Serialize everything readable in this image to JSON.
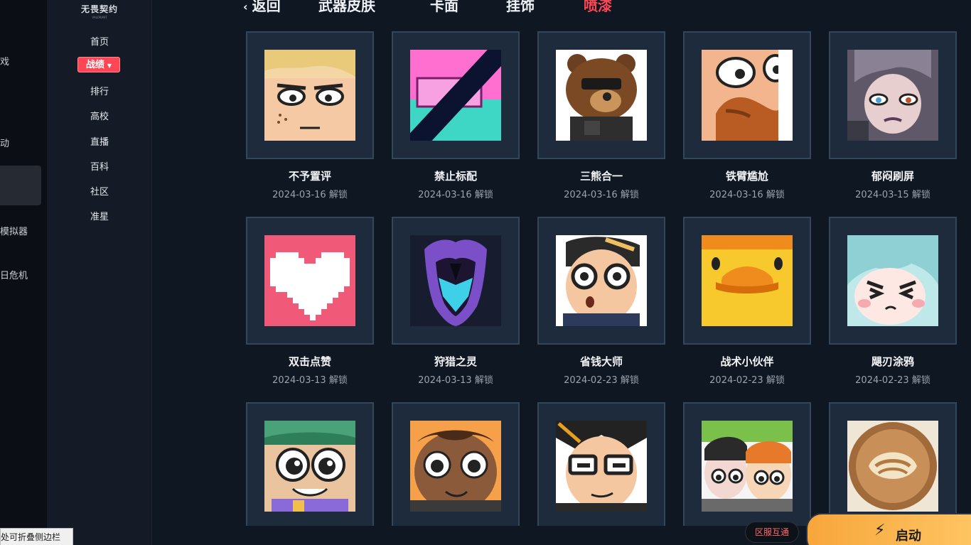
{
  "outer_sidebar": {
    "items": [
      "戏",
      "动",
      "模拟器",
      "日危机"
    ]
  },
  "game_sidebar": {
    "logo": "无畏契约",
    "logo_sub": "VALORANT",
    "nav": [
      {
        "label": "首页"
      },
      {
        "label": "战绩"
      },
      {
        "label": "排行"
      },
      {
        "label": "高校"
      },
      {
        "label": "直播"
      },
      {
        "label": "百科"
      },
      {
        "label": "社区"
      },
      {
        "label": "准星"
      }
    ],
    "active_index": 1
  },
  "tabs": {
    "back": "返回",
    "items": [
      "武器皮肤",
      "卡面",
      "挂饰",
      "喷漆"
    ],
    "active": "喷漆"
  },
  "sprays": [
    {
      "name": "不予置评",
      "date": "2024-03-16 解锁",
      "art": "blond-boy"
    },
    {
      "name": "禁止标配",
      "date": "2024-03-16 解锁",
      "art": "banned-gun"
    },
    {
      "name": "三熊合一",
      "date": "2024-03-16 解锁",
      "art": "bear"
    },
    {
      "name": "铁臂尴尬",
      "date": "2024-03-16 解锁",
      "art": "bearded-man"
    },
    {
      "name": "郁闷刷屏",
      "date": "2024-03-15 解锁",
      "art": "grumpy-girl"
    },
    {
      "name": "双击点赞",
      "date": "2024-03-13 解锁",
      "art": "pixel-heart"
    },
    {
      "name": "狩猎之灵",
      "date": "2024-03-13 解锁",
      "art": "spirit-mask"
    },
    {
      "name": "省钱大师",
      "date": "2024-02-23 解锁",
      "art": "glasses-guy"
    },
    {
      "name": "战术小伙伴",
      "date": "2024-02-23 解锁",
      "art": "duck"
    },
    {
      "name": "飓刃涂鸦",
      "date": "2024-02-23 解锁",
      "art": "angry-girl"
    },
    {
      "name": "",
      "date": "",
      "art": "glasses-girl"
    },
    {
      "name": "",
      "date": "",
      "art": "smiling-boy"
    },
    {
      "name": "",
      "date": "",
      "art": "smug-glasses"
    },
    {
      "name": "",
      "date": "",
      "art": "duo"
    },
    {
      "name": "",
      "date": "",
      "art": "latte-art"
    }
  ],
  "footer": {
    "region_label": "区服互通",
    "launch_label": "启动",
    "tooltip": "处可折叠侧边栏"
  },
  "colors": {
    "accent": "#ff4655",
    "launch": "#f7a63b",
    "card_border": "#34465a"
  }
}
